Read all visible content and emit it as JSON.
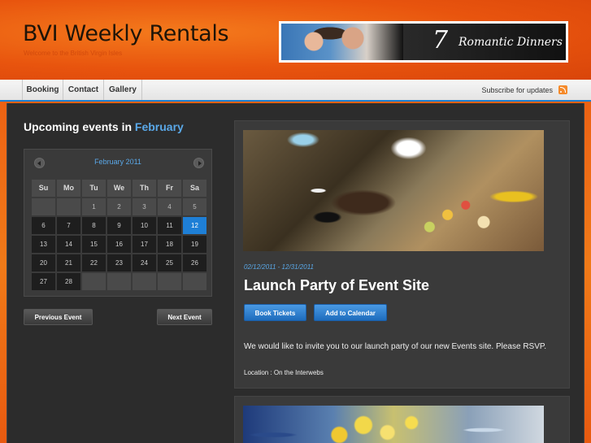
{
  "header": {
    "site_title": "BVI Weekly Rentals",
    "tagline": "Welcome to the British Virgin Isles",
    "banner": {
      "number": "7",
      "text": "Romantic Dinners"
    }
  },
  "nav": {
    "items": [
      {
        "label": "Booking"
      },
      {
        "label": "Contact"
      },
      {
        "label": "Gallery"
      }
    ],
    "subscribe_label": "Subscribe for updates"
  },
  "sidebar": {
    "heading_prefix": "Upcoming events in",
    "heading_month": "February",
    "calendar": {
      "title": "February 2011",
      "weekdays": [
        "Su",
        "Mo",
        "Tu",
        "We",
        "Th",
        "Fr",
        "Sa"
      ],
      "weeks": [
        [
          "",
          "",
          "1",
          "2",
          "3",
          "4",
          "5"
        ],
        [
          "6",
          "7",
          "8",
          "9",
          "10",
          "11",
          "12"
        ],
        [
          "13",
          "14",
          "15",
          "16",
          "17",
          "18",
          "19"
        ],
        [
          "20",
          "21",
          "22",
          "23",
          "24",
          "25",
          "26"
        ],
        [
          "27",
          "28",
          "",
          "",
          "",
          "",
          ""
        ]
      ],
      "selected_day": "12"
    },
    "prev_event_label": "Previous Event",
    "next_event_label": "Next Event"
  },
  "event": {
    "date_range": "02/12/2011 - 12/31/2011",
    "title": "Launch Party of Event Site",
    "book_label": "Book Tickets",
    "calendar_label": "Add to Calendar",
    "description": "We would like to invite you to our launch party of our new Events site. Please RSVP.",
    "location": "Location : On the Interwebs"
  },
  "colors": {
    "accent": "#1e7fd6",
    "link": "#5aa8e8",
    "header_orange": "#e8540e"
  }
}
